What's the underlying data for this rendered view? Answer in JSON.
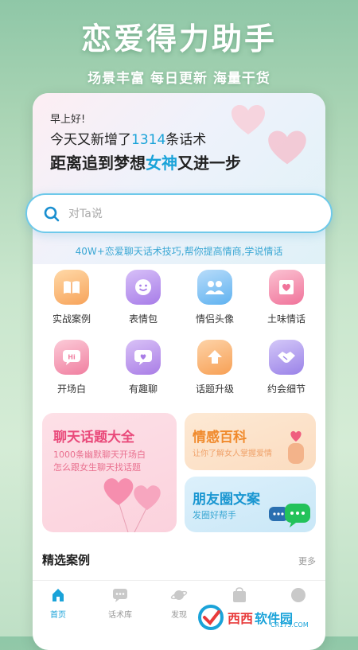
{
  "promo": {
    "title": "恋爱得力助手",
    "subtitle": "场景丰富 每日更新 海量干货"
  },
  "hero": {
    "greeting": "早上好!",
    "update_prefix": "今天又新增了",
    "update_count": "1314",
    "update_suffix": "条话术",
    "slogan_prefix": "距离追到梦想",
    "slogan_accent": "女神",
    "slogan_suffix": "又进一步"
  },
  "search": {
    "placeholder": "对Ta说",
    "tagline": "40W+恋爱聊天话术技巧,帮你提高情商,学说情话"
  },
  "features": [
    {
      "label": "实战案例",
      "icon": "book-icon",
      "color": "#f7a35a"
    },
    {
      "label": "表情包",
      "icon": "smiley-icon",
      "color": "#a77ce8"
    },
    {
      "label": "情侣头像",
      "icon": "couple-avatar-icon",
      "color": "#5fb2f0"
    },
    {
      "label": "土味情话",
      "icon": "love-letter-icon",
      "color": "#f0739a"
    },
    {
      "label": "开场白",
      "icon": "hi-bubble-icon",
      "color": "#f07fa0"
    },
    {
      "label": "有趣聊",
      "icon": "chat-heart-icon",
      "color": "#a97de6"
    },
    {
      "label": "话题升级",
      "icon": "arrow-up-icon",
      "color": "#f7a055"
    },
    {
      "label": "约会细节",
      "icon": "handshake-icon",
      "color": "#9a82e8"
    }
  ],
  "cards": {
    "topics": {
      "title": "聊天话题大全",
      "line1": "1000条幽默聊天开场白",
      "line2": "怎么跟女生聊天找话题"
    },
    "encyclopedia": {
      "title": "情感百科",
      "subtitle": "让你了解女人掌握爱情"
    },
    "moments": {
      "title": "朋友圈文案",
      "subtitle": "发圈好帮手"
    }
  },
  "section": {
    "title": "精选案例",
    "more": "更多"
  },
  "tabs": [
    {
      "label": "首页",
      "icon": "home-icon",
      "active": true
    },
    {
      "label": "话术库",
      "icon": "chat-library-icon",
      "active": false
    },
    {
      "label": "发现",
      "icon": "planet-icon",
      "active": false
    },
    {
      "label": "",
      "icon": "bag-icon",
      "active": false
    },
    {
      "label": "",
      "icon": "profile-icon",
      "active": false
    }
  ],
  "watermark": {
    "brand": "西西",
    "brand2": "软件园",
    "url": "CR173.COM"
  },
  "colors": {
    "accent": "#1aa3d9",
    "pink": "#e9497a",
    "orange": "#f08a2c",
    "blue": "#1996d1"
  }
}
